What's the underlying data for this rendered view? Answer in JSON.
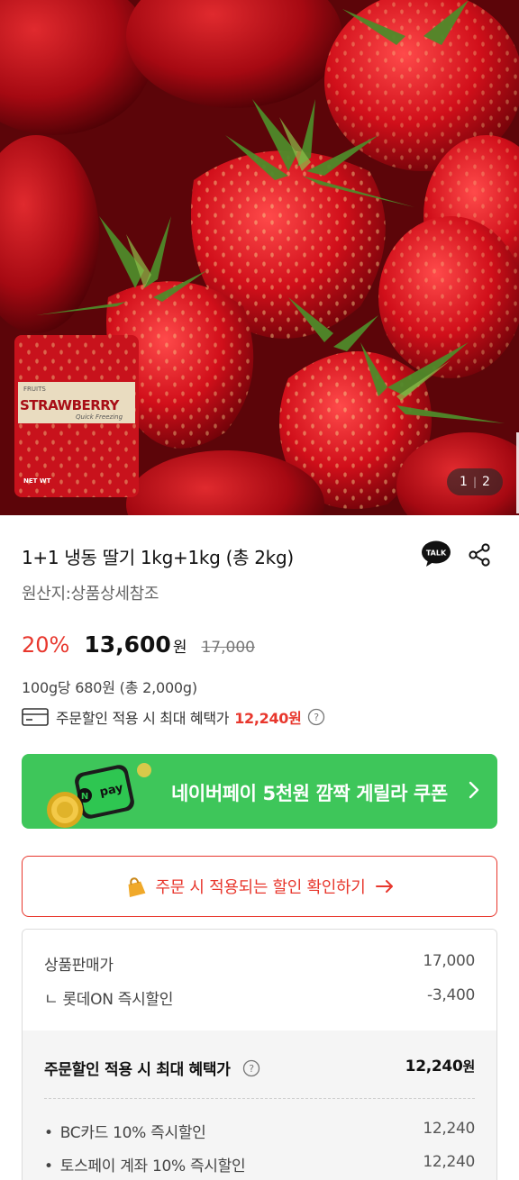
{
  "hero": {
    "pager_current": "1",
    "pager_total": "2",
    "package": {
      "brand": "FRUITS",
      "name": "STRAWBERRY",
      "tagline": "Quick Freezing",
      "weight": "NET WT"
    }
  },
  "product": {
    "title": "1+1 냉동 딸기 1kg+1kg (총 2kg)",
    "origin": "원산지:상품상세참조"
  },
  "icons": {
    "talk": "kakao-talk-icon",
    "talk_text": "TALK",
    "share": "share-icon"
  },
  "price": {
    "discount_rate": "20%",
    "sale_price": "13,600",
    "currency": "원",
    "original_price": "17,000",
    "unit_price": "100g당 680원 (총 2,000g)",
    "benefit_label": "주문할인 적용 시 최대 혜택가",
    "benefit_amount": "12,240원"
  },
  "npay_banner": {
    "badge": "pay",
    "text": "네이버페이 5천원 깜짝 게릴라 쿠폰",
    "color": "#3ec65a"
  },
  "check_button": {
    "label": "주문 시 적용되는 할인 확인하기",
    "color": "#e8372d"
  },
  "breakdown": {
    "sale_label": "상품판매가",
    "sale_value": "17,000",
    "instant_label": "ㄴ 롯데ON 즉시할인",
    "instant_value": "-3,400",
    "max_label": "주문할인 적용 시 최대 혜택가",
    "max_value": "12,240",
    "max_currency": "원",
    "items": [
      {
        "label": "BC카드 10% 즉시할인",
        "value": "12,240"
      },
      {
        "label": "토스페이 계좌 10% 즉시할인",
        "value": "12,240"
      }
    ]
  }
}
